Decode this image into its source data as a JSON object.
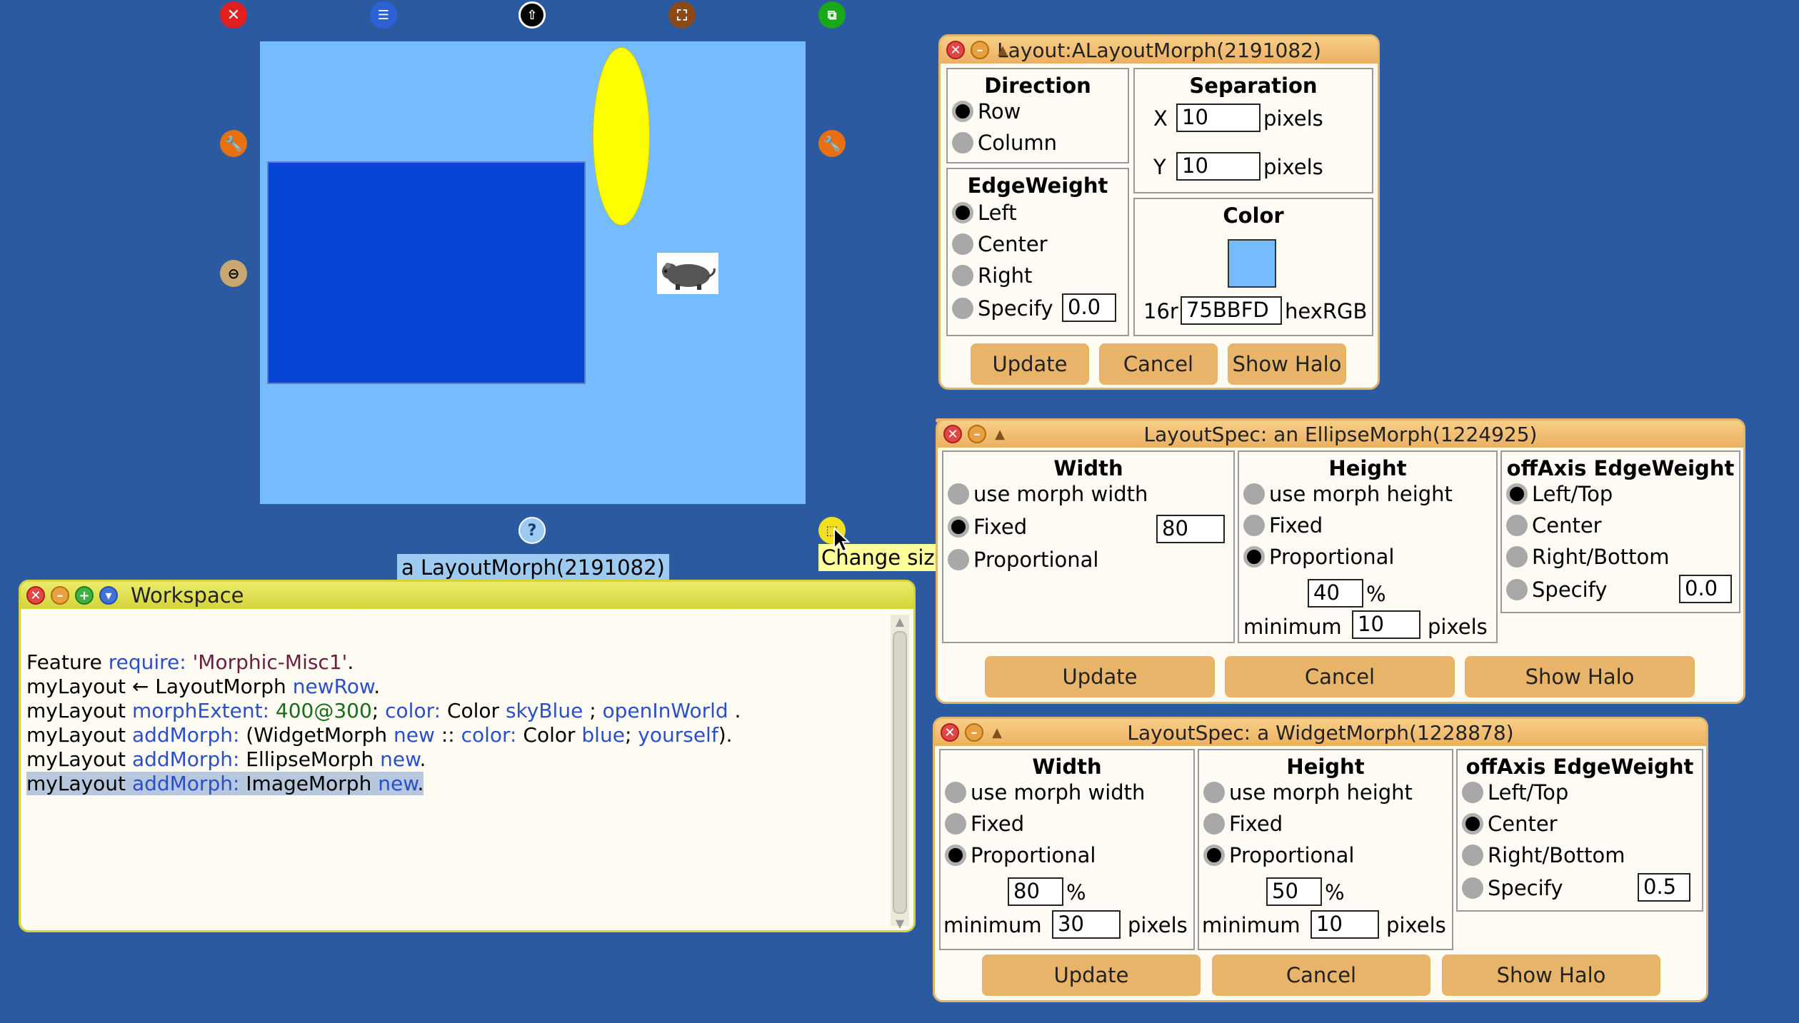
{
  "halo": {
    "label": "a LayoutMorph(2191082)",
    "tooltip": "Change size",
    "icons": [
      "close-icon",
      "menu-icon",
      "pickup-icon",
      "move-icon",
      "duplicate-icon",
      "debug-icon",
      "collapse-icon",
      "help-icon",
      "resize-icon",
      "rotate-icon"
    ]
  },
  "layout_window": {
    "title": "Layout:ALayoutMorph(2191082)",
    "direction": {
      "heading": "Direction",
      "options": [
        "Row",
        "Column"
      ],
      "selected": "Row"
    },
    "separation": {
      "heading": "Separation",
      "x_label": "X",
      "x_value": "10",
      "y_label": "Y",
      "y_value": "10",
      "unit": "pixels"
    },
    "edge_weight": {
      "heading": "EdgeWeight",
      "options": [
        "Left",
        "Center",
        "Right",
        "Specify"
      ],
      "selected": "Left",
      "specify_value": "0.0"
    },
    "color": {
      "heading": "Color",
      "prefix": "16r",
      "value": "75BBFD",
      "suffix": "hexRGB",
      "swatch": "#75bbfd"
    },
    "buttons": {
      "update": "Update",
      "cancel": "Cancel",
      "show_halo": "Show Halo"
    }
  },
  "ellipse_spec": {
    "title": "LayoutSpec: an EllipseMorph(1224925)",
    "width": {
      "heading": "Width",
      "options": [
        "use morph width",
        "Fixed",
        "Proportional"
      ],
      "selected": "Fixed",
      "fixed_value": "80"
    },
    "height": {
      "heading": "Height",
      "options": [
        "use morph height",
        "Fixed",
        "Proportional"
      ],
      "selected": "Proportional",
      "percent_value": "40",
      "percent_unit": "%",
      "min_label": "minimum",
      "min_value": "10",
      "min_unit": "pixels"
    },
    "off_axis": {
      "heading": "offAxis EdgeWeight",
      "options": [
        "Left/Top",
        "Center",
        "Right/Bottom",
        "Specify"
      ],
      "selected": "Left/Top",
      "specify_value": "0.0"
    },
    "buttons": {
      "update": "Update",
      "cancel": "Cancel",
      "show_halo": "Show Halo"
    }
  },
  "widget_spec": {
    "title": "LayoutSpec: a WidgetMorph(1228878)",
    "width": {
      "heading": "Width",
      "options": [
        "use morph width",
        "Fixed",
        "Proportional"
      ],
      "selected": "Proportional",
      "percent_value": "80",
      "percent_unit": "%",
      "min_label": "minimum",
      "min_value": "30",
      "min_unit": "pixels"
    },
    "height": {
      "heading": "Height",
      "options": [
        "use morph height",
        "Fixed",
        "Proportional"
      ],
      "selected": "Proportional",
      "percent_value": "50",
      "percent_unit": "%",
      "min_label": "minimum",
      "min_value": "10",
      "min_unit": "pixels"
    },
    "off_axis": {
      "heading": "offAxis EdgeWeight",
      "options": [
        "Left/Top",
        "Center",
        "Right/Bottom",
        "Specify"
      ],
      "selected": "Center",
      "specify_value": "0.5"
    },
    "buttons": {
      "update": "Update",
      "cancel": "Cancel",
      "show_halo": "Show Halo"
    }
  },
  "workspace": {
    "title": "Workspace",
    "lines": [
      [
        [
          "Feature ",
          ""
        ],
        [
          "require: ",
          "kw"
        ],
        [
          "'Morphic-Misc1'",
          "str"
        ],
        [
          ".",
          ""
        ]
      ],
      [
        [
          "myLayout ← LayoutMorph ",
          ""
        ],
        [
          "newRow",
          "kw"
        ],
        [
          ".",
          ""
        ]
      ],
      [
        [
          "myLayout ",
          ""
        ],
        [
          "morphExtent: ",
          "kw"
        ],
        [
          "400@300",
          "num"
        ],
        [
          "; ",
          ""
        ],
        [
          "color: ",
          "kw"
        ],
        [
          "Color ",
          ""
        ],
        [
          "skyBlue",
          "kw"
        ],
        [
          " ; ",
          ""
        ],
        [
          "openInWorld",
          "kw"
        ],
        [
          " .",
          ""
        ]
      ],
      [
        [
          "myLayout ",
          ""
        ],
        [
          "addMorph: ",
          "kw"
        ],
        [
          "(WidgetMorph ",
          ""
        ],
        [
          "new",
          "kw"
        ],
        [
          " :: ",
          ""
        ],
        [
          "color: ",
          "kw"
        ],
        [
          "Color ",
          ""
        ],
        [
          "blue",
          "kw"
        ],
        [
          "; ",
          ""
        ],
        [
          "yourself",
          "kw"
        ],
        [
          ").",
          ""
        ]
      ],
      [
        [
          "myLayout ",
          ""
        ],
        [
          "addMorph: ",
          "kw"
        ],
        [
          "EllipseMorph ",
          ""
        ],
        [
          "new",
          "kw"
        ],
        [
          ".",
          ""
        ]
      ],
      [
        [
          "myLayout ",
          ""
        ],
        [
          "addMorph: ",
          "kw"
        ],
        [
          "ImageMorph ",
          ""
        ],
        [
          "new",
          "kw"
        ],
        [
          ".",
          ""
        ]
      ]
    ],
    "selected_line": 5
  },
  "colors": {
    "desktop": "#2b5aa0",
    "layout_bg": "#75bbfd",
    "widget": "#0645d6",
    "ellipse": "#ffff00"
  }
}
